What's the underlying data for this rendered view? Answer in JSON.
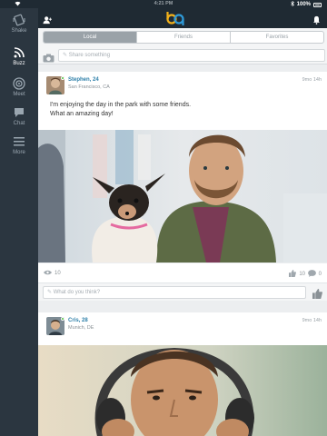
{
  "status_bar": {
    "time": "4:21 PM",
    "battery": "100%"
  },
  "sidebar": {
    "items": [
      {
        "label": "Shake",
        "icon": "shake-icon",
        "active": false
      },
      {
        "label": "Buzz",
        "icon": "rss-icon",
        "active": true
      },
      {
        "label": "Meet",
        "icon": "target-icon",
        "active": false
      },
      {
        "label": "Chat",
        "icon": "chat-bubble-icon",
        "active": false
      },
      {
        "label": "More",
        "icon": "menu-icon",
        "active": false
      }
    ]
  },
  "topbar": {
    "logo_icon": "badoo-bq-logo"
  },
  "tabs": [
    {
      "label": "Local",
      "active": true
    },
    {
      "label": "Friends",
      "active": false
    },
    {
      "label": "Favorites",
      "active": false
    }
  ],
  "share": {
    "placeholder": "Share something"
  },
  "posts": [
    {
      "author": "Stephen, 24",
      "location": "San Francisco, CA",
      "time": "9mo 14h",
      "text_lines": [
        "I'm enjoying the day in the park with some friends.",
        "What an amazing day!"
      ],
      "views": "10",
      "likes": "10",
      "comments": "0",
      "comment_placeholder": "What do you think?"
    },
    {
      "author": "Cris, 28",
      "location": "Munich, DE",
      "time": "9mo 14h"
    }
  ],
  "colors": {
    "sidebar_bg": "#2b3640",
    "topbar_bg": "#1f2a33",
    "author_link": "#2d7fa9",
    "online": "#48c23b"
  }
}
